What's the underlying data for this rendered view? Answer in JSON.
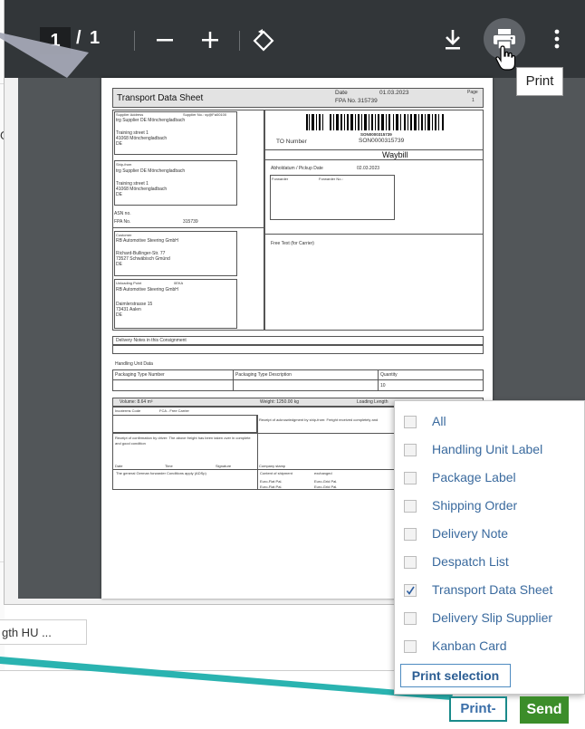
{
  "viewer": {
    "page_current": "1",
    "page_separator": "/",
    "page_total": "1",
    "tooltip": "Print"
  },
  "background": {
    "left_char": "G",
    "row_text": "gth HU ..."
  },
  "document": {
    "title": "Transport Data Sheet",
    "date_label": "Date",
    "date_value": "01.03.2023",
    "fpa_label": "FPA No.",
    "fpa_value": "315739",
    "page_label": "Page",
    "page_value": "1",
    "supplier_label": "Supplier Address",
    "supplier_no_label": "Supplier No.: sy@Fa00100",
    "supplier_lines": [
      "trg Supplier DE Mönchengladbach",
      "",
      "Training street 1",
      "41068 Mönchengladbach",
      "DE"
    ],
    "shipfrom_label": "Ship-from",
    "shipfrom_lines": [
      "trg Supplier DE Mönchengladbach",
      "",
      "Training street 1",
      "41068 Mönchengladbach",
      "DE"
    ],
    "asn_label": "ASN no.",
    "fpa_no_label": "FPA No.",
    "fpa_no_value": "315739",
    "customer_label": "Customer",
    "customer_lines": [
      "RB Automotive Steering GmbH",
      "",
      "Richard-Bullinger-Str. 77",
      "73527 Schwäbisch Gmünd",
      "DE"
    ],
    "unloading_label": "Unloading Point",
    "unloading_code": "0EKA",
    "unloading_lines": [
      "RB Automotive Steering GmbH",
      "",
      "Daimlerstrasse 15",
      "73431 Aalen",
      "DE"
    ],
    "barcode_text": "SON0000315739",
    "to_number_label": "TO Number",
    "to_number_value": "SON0000315739",
    "waybill": "Waybill",
    "pickup_label": "Abholdatum / Pickup Date",
    "pickup_value": "02.03.2023",
    "forwarder_label": "Forwarder",
    "forwarder_no_label": "Forwarder No.:",
    "free_text_label": "Free Text (for Carrier)",
    "delivery_notes_label": "Delivery Notes in this Consignment",
    "hu_data_label": "Handling Unit Data",
    "pkg_type_number": "Packaging Type Number",
    "pkg_type_desc": "Packaging Type Description",
    "quantity": "Quantity",
    "quantity_value": "10",
    "volume": "Volume: 8.64 m³",
    "weight": "Weight: 1250.00 kg",
    "loading_length": "Loading Length",
    "incoterms_label": "Incoterms Code",
    "incoterms_value": "FCA - Free Carrier",
    "receipt_ack": "Receipt of acknowledgment by ship-from: Freight received completely and",
    "receipt_confirm": "Receipt of confirmation by driver: The above freight has been taken over in complete and good condition",
    "date_col": "Date",
    "time_col": "Time",
    "signature_col": "Signature",
    "company_stamp": "Company stamp",
    "content_label": "Content of shipment",
    "exchanged_label": "exchanged",
    "conditions": "The general German forwarder Conditions apply (ADSp)",
    "pallet_rows": [
      [
        "Euro-Flat Pal.",
        "Euro-Grid Pal."
      ],
      [
        "Euro-Flat Pal.",
        "Euro-Grid Pal."
      ]
    ]
  },
  "print_menu": {
    "items": [
      {
        "label": "All",
        "checked": false
      },
      {
        "label": "Handling Unit Label",
        "checked": false
      },
      {
        "label": "Package Label",
        "checked": false
      },
      {
        "label": "Shipping Order",
        "checked": false
      },
      {
        "label": "Delivery Note",
        "checked": false
      },
      {
        "label": "Despatch List",
        "checked": false
      },
      {
        "label": "Transport Data Sheet",
        "checked": true
      },
      {
        "label": "Delivery Slip Supplier",
        "checked": false
      },
      {
        "label": "Kanban Card",
        "checked": false
      }
    ],
    "print_selection": "Print selection"
  },
  "buttons": {
    "print": "Print",
    "send": "Send"
  },
  "icons": {
    "zoom_out": "minus-icon",
    "zoom_in": "plus-icon",
    "rotate": "rotate-icon",
    "download": "download-icon",
    "print": "print-icon",
    "more": "more-vert-icon",
    "cursor": "hand-cursor-icon"
  },
  "colors": {
    "toolbar": "#323639",
    "viewer_bg": "#525659",
    "menu_text": "#3a6a9e",
    "send": "#3c8d2a",
    "callout_teal": "#1aa3a3"
  }
}
